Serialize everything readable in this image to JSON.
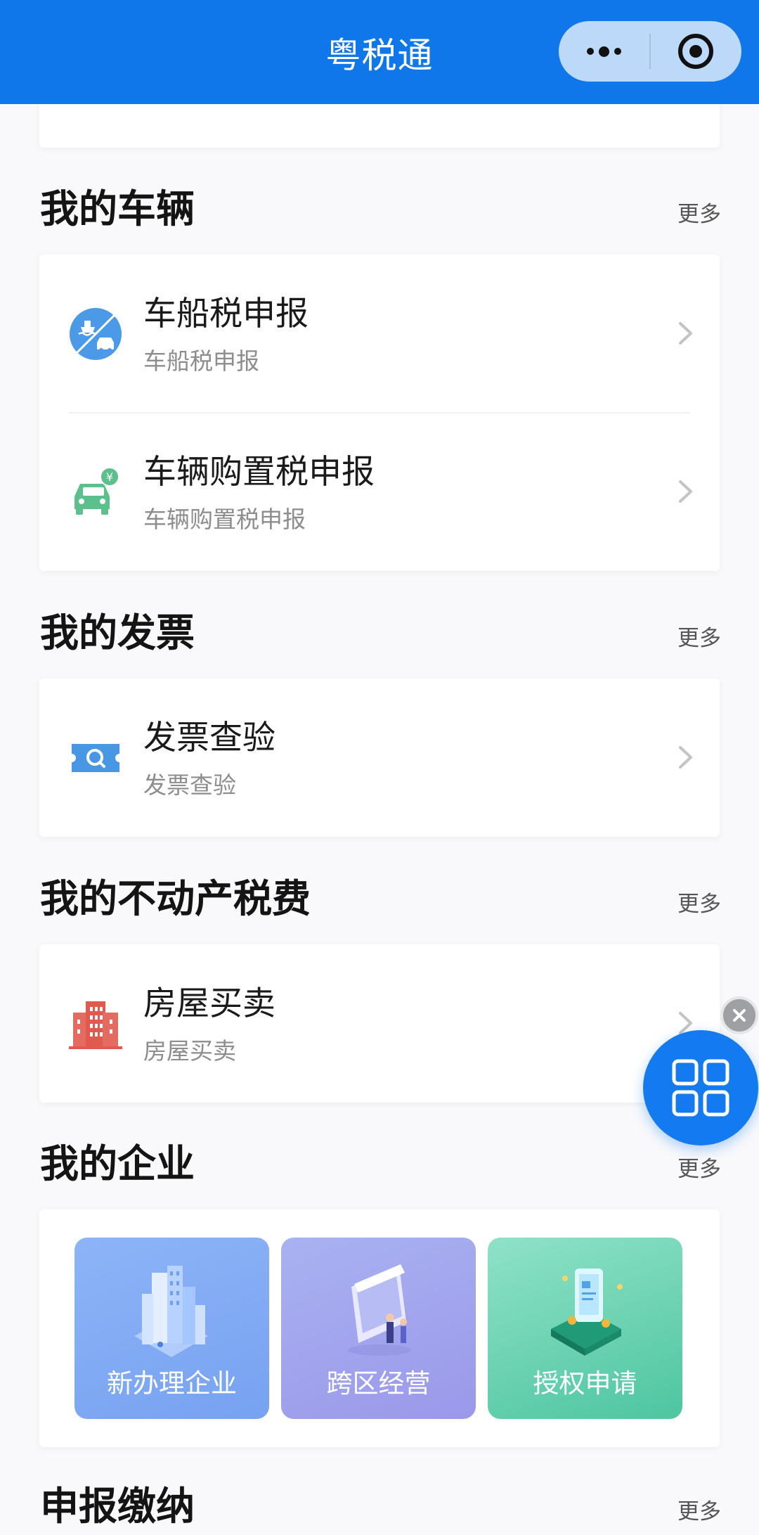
{
  "app": {
    "title": "粤税通"
  },
  "sections": {
    "vehicles": {
      "title": "我的车辆",
      "more": "更多",
      "items": [
        {
          "title": "车船税申报",
          "subtitle": "车船税申报",
          "icon": "ship-car-icon"
        },
        {
          "title": "车辆购置税申报",
          "subtitle": "车辆购置税申报",
          "icon": "car-yen-icon"
        }
      ]
    },
    "invoices": {
      "title": "我的发票",
      "more": "更多",
      "items": [
        {
          "title": "发票查验",
          "subtitle": "发票查验",
          "icon": "invoice-search-icon"
        }
      ]
    },
    "realestate": {
      "title": "我的不动产税费",
      "more": "更多",
      "items": [
        {
          "title": "房屋买卖",
          "subtitle": "房屋买卖",
          "icon": "building-icon"
        }
      ]
    },
    "enterprise": {
      "title": "我的企业",
      "more": "更多",
      "tiles": [
        {
          "label": "新办理企业",
          "color": "#7ea8f3"
        },
        {
          "label": "跨区经营",
          "color": "#a2a4ee"
        },
        {
          "label": "授权申请",
          "color": "#5fcfac"
        }
      ]
    },
    "filing": {
      "title": "申报缴纳",
      "more": "更多"
    }
  },
  "colors": {
    "brand": "#0f77ea",
    "fab": "#137af0"
  }
}
